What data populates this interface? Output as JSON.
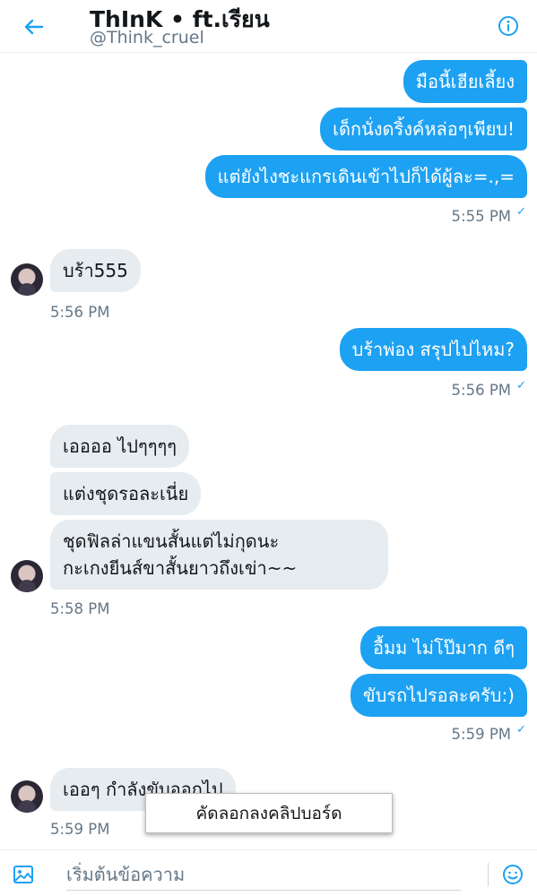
{
  "header": {
    "title": "ThInK • ft.เรียน",
    "handle": "@Think_cruel"
  },
  "messages": [
    {
      "text": "มือนี้เฮียเลี้ยง"
    },
    {
      "text": "เด็กนั่งดริ้งค์หล่อๆเพียบ!"
    },
    {
      "text": "แต่ยังไงชะแกรเดินเข้าไปก็ได้ผู้ละ=.,="
    },
    {
      "text": "บร้า555"
    },
    {
      "text": "บร้าพ่อง สรุปไปไหม?"
    },
    {
      "text": "เออออ ไปๆๆๆๆ"
    },
    {
      "text": "แต่งชุดรอละเนี่ย"
    },
    {
      "line1": "ชุดฟิลล่าแขนสั้นแต่ไม่กุดนะ",
      "line2": "กะเกงยีนส์ขาสั้นยาวถึงเข่า~~"
    },
    {
      "text": "อื้มม ไม่โป๊มาก ดีๆ"
    },
    {
      "text": "ขับรถไปรอละครับ:)"
    },
    {
      "text": "เออๆ กำลังขับออกไป"
    }
  ],
  "timestamps": [
    "5:55 PM",
    "5:56 PM",
    "5:56 PM",
    "5:58 PM",
    "5:59 PM",
    "5:59 PM"
  ],
  "context_menu": {
    "copy_label": "คัดลอกลงคลิปบอร์ด"
  },
  "composer": {
    "placeholder": "เริ่มต้นข้อความ"
  },
  "colors": {
    "accent": "#1da1f2",
    "incoming_bubble": "#e6ecf0",
    "muted_text": "#657786"
  }
}
